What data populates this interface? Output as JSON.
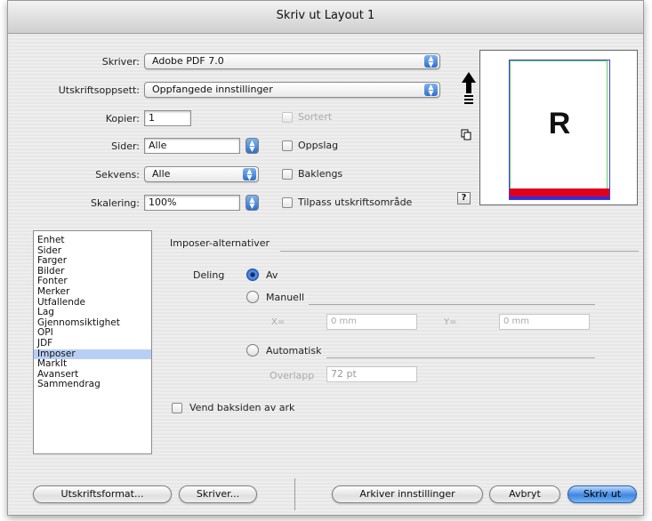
{
  "window": {
    "title": "Skriv ut Layout 1"
  },
  "printer": {
    "label": "Skriver:",
    "value": "Adobe PDF 7.0"
  },
  "preset": {
    "label": "Utskriftsoppsett:",
    "value": "Oppfangede innstillinger"
  },
  "copies": {
    "label": "Kopier:",
    "value": "1"
  },
  "pages": {
    "label": "Sider:",
    "value": "Alle"
  },
  "sequence": {
    "label": "Sekvens:",
    "value": "Alle"
  },
  "scale": {
    "label": "Skalering:",
    "value": "100%"
  },
  "options": {
    "collate": "Sortert",
    "spreads": "Oppslag",
    "reverse": "Baklengs",
    "fit": "Tilpass utskriftsområde"
  },
  "preview": {
    "page_letter": "R",
    "help": "?"
  },
  "sidebar": {
    "items": [
      "Enhet",
      "Sider",
      "Farger",
      "Bilder",
      "Fonter",
      "Merker",
      "Utfallende",
      "Lag",
      "Gjennomsiktighet",
      "OPI",
      "JDF",
      "Imposer",
      "MarkIt",
      "Avansert",
      "Sammendrag"
    ],
    "selected": "Imposer"
  },
  "imposer": {
    "heading": "Imposer-alternativer",
    "tiling_label": "Deling",
    "off_label": "Av",
    "manual_label": "Manuell",
    "x_label": "X=",
    "x_value": "0 mm",
    "y_label": "Y=",
    "y_value": "0 mm",
    "auto_label": "Automatisk",
    "overlap_label": "Overlapp",
    "overlap_value": "72 pt",
    "flip_back": "Vend baksiden av ark"
  },
  "buttons": {
    "page_setup": "Utskriftsformat...",
    "printer": "Skriver...",
    "save_settings": "Arkiver innstillinger",
    "cancel": "Avbryt",
    "print": "Skriv ut"
  },
  "colors": {
    "accent": "#3f86e0",
    "selection": "#b8cff5",
    "bleed_red": "#e0001b",
    "bleed_blue": "#3a2bd8"
  }
}
